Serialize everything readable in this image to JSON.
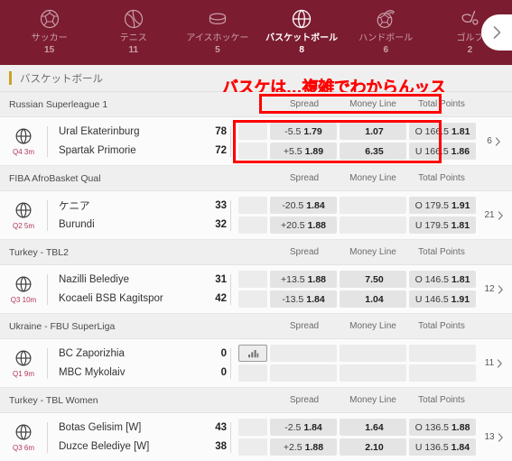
{
  "colors": {
    "header_bg": "#7c1c31",
    "accent_gold": "#c9a227",
    "annotation_red": "#ff0000",
    "period_red": "#b3365a",
    "odds_cell_bg": "#e4e4e4"
  },
  "sports_nav": {
    "next_icon": "chevron-right-icon",
    "items": [
      {
        "label": "サッカー",
        "count": "15",
        "icon": "soccer-ball-icon",
        "active": false
      },
      {
        "label": "テニス",
        "count": "11",
        "icon": "tennis-ball-icon",
        "active": false
      },
      {
        "label": "アイスホッケー",
        "count": "5",
        "icon": "hockey-puck-icon",
        "active": false
      },
      {
        "label": "バスケットボール",
        "count": "8",
        "icon": "basketball-icon",
        "active": true
      },
      {
        "label": "ハンドボール",
        "count": "6",
        "icon": "handball-icon",
        "active": false
      },
      {
        "label": "ゴルフ",
        "count": "2",
        "icon": "golf-club-icon",
        "active": false
      }
    ]
  },
  "breadcrumb": {
    "label": "バスケットボール"
  },
  "annotation": {
    "text": "バスケは…複雑でわからんッス"
  },
  "columns": {
    "spread": "Spread",
    "money_line": "Money Line",
    "total_points": "Total Points"
  },
  "leagues": [
    {
      "name": "Russian Superleague 1",
      "highlight_headers": true,
      "match": {
        "period": "Q4 3m",
        "more_count": "6",
        "has_stats_icon": false,
        "highlight_odds": true,
        "teams": [
          {
            "name": "Ural Ekaterinburg",
            "score": "78"
          },
          {
            "name": "Spartak Primorie",
            "score": "72"
          }
        ],
        "spread": [
          {
            "line": "-5.5",
            "price": "1.79"
          },
          {
            "line": "+5.5",
            "price": "1.89"
          }
        ],
        "money_line": [
          {
            "line": "",
            "price": "1.07"
          },
          {
            "line": "",
            "price": "6.35"
          }
        ],
        "total_points": [
          {
            "line": "O 166.5",
            "price": "1.81"
          },
          {
            "line": "U 166.5",
            "price": "1.86"
          }
        ]
      }
    },
    {
      "name": "FIBA AfroBasket Qual",
      "highlight_headers": false,
      "match": {
        "period": "Q2 5m",
        "more_count": "21",
        "has_stats_icon": false,
        "highlight_odds": false,
        "teams": [
          {
            "name": "ケニア",
            "score": "33"
          },
          {
            "name": "Burundi",
            "score": "32"
          }
        ],
        "spread": [
          {
            "line": "-20.5",
            "price": "1.84"
          },
          {
            "line": "+20.5",
            "price": "1.88"
          }
        ],
        "money_line": [
          {
            "line": "",
            "price": ""
          },
          {
            "line": "",
            "price": ""
          }
        ],
        "total_points": [
          {
            "line": "O 179.5",
            "price": "1.91"
          },
          {
            "line": "U 179.5",
            "price": "1.81"
          }
        ]
      }
    },
    {
      "name": "Turkey - TBL2",
      "highlight_headers": false,
      "match": {
        "period": "Q3 10m",
        "more_count": "12",
        "has_stats_icon": false,
        "highlight_odds": false,
        "teams": [
          {
            "name": "Nazilli Belediye",
            "score": "31"
          },
          {
            "name": "Kocaeli BSB Kagitspor",
            "score": "42"
          }
        ],
        "spread": [
          {
            "line": "+13.5",
            "price": "1.88"
          },
          {
            "line": "-13.5",
            "price": "1.84"
          }
        ],
        "money_line": [
          {
            "line": "",
            "price": "7.50"
          },
          {
            "line": "",
            "price": "1.04"
          }
        ],
        "total_points": [
          {
            "line": "O 146.5",
            "price": "1.81"
          },
          {
            "line": "U 146.5",
            "price": "1.91"
          }
        ]
      }
    },
    {
      "name": "Ukraine - FBU SuperLiga",
      "highlight_headers": false,
      "match": {
        "period": "Q1 9m",
        "more_count": "11",
        "has_stats_icon": true,
        "highlight_odds": false,
        "teams": [
          {
            "name": "BC Zaporizhia",
            "score": "0"
          },
          {
            "name": "MBC Mykolaiv",
            "score": "0"
          }
        ],
        "spread": [
          {
            "line": "",
            "price": ""
          },
          {
            "line": "",
            "price": ""
          }
        ],
        "money_line": [
          {
            "line": "",
            "price": ""
          },
          {
            "line": "",
            "price": ""
          }
        ],
        "total_points": [
          {
            "line": "",
            "price": ""
          },
          {
            "line": "",
            "price": ""
          }
        ]
      }
    },
    {
      "name": "Turkey - TBL Women",
      "highlight_headers": false,
      "match": {
        "period": "Q3 6m",
        "more_count": "13",
        "has_stats_icon": false,
        "highlight_odds": false,
        "teams": [
          {
            "name": "Botas Gelisim [W]",
            "score": "43"
          },
          {
            "name": "Duzce Belediye [W]",
            "score": "38"
          }
        ],
        "spread": [
          {
            "line": "-2.5",
            "price": "1.84"
          },
          {
            "line": "+2.5",
            "price": "1.88"
          }
        ],
        "money_line": [
          {
            "line": "",
            "price": "1.64"
          },
          {
            "line": "",
            "price": "2.10"
          }
        ],
        "total_points": [
          {
            "line": "O 136.5",
            "price": "1.88"
          },
          {
            "line": "U 136.5",
            "price": "1.84"
          }
        ]
      }
    }
  ]
}
